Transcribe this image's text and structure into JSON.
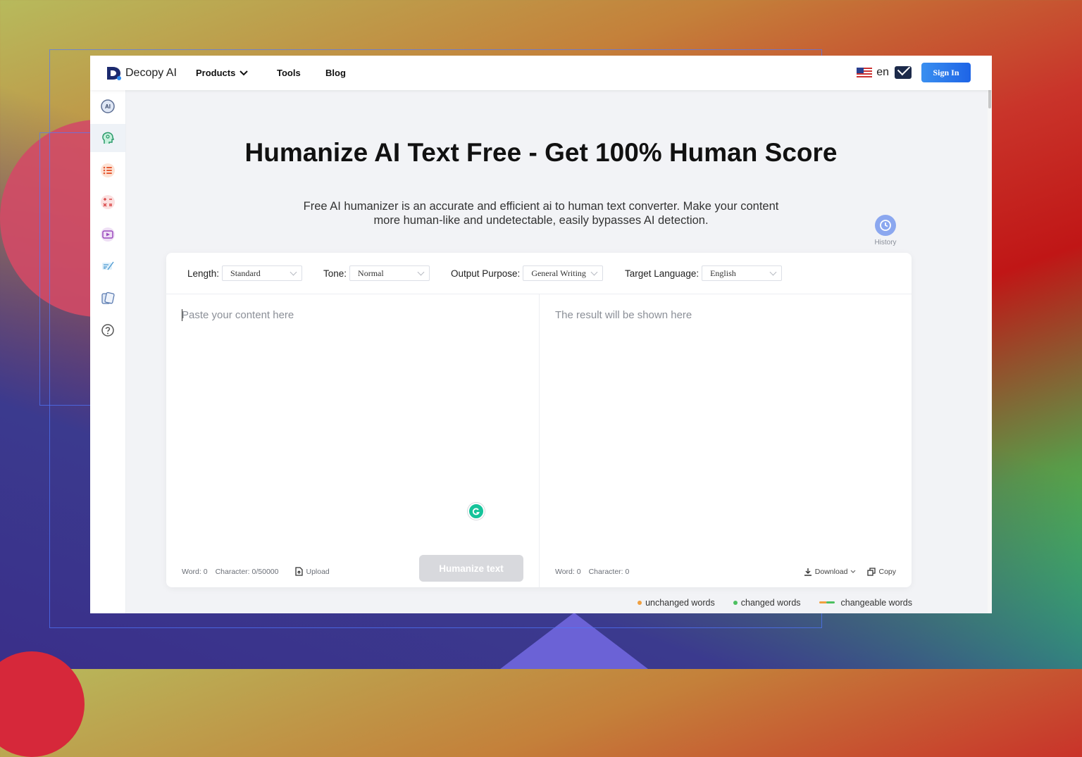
{
  "brand": {
    "name": "Decopy AI"
  },
  "nav": {
    "items": [
      {
        "label": "Products",
        "has_dropdown": true
      },
      {
        "label": "Tools",
        "has_dropdown": false
      },
      {
        "label": "Blog",
        "has_dropdown": false
      }
    ],
    "language": "en",
    "sign_in_label": "Sign In"
  },
  "sidebar": {
    "items": [
      {
        "icon": "ai-detector-icon",
        "active": false
      },
      {
        "icon": "humanizer-head-icon",
        "active": true
      },
      {
        "icon": "list-icon",
        "active": false
      },
      {
        "icon": "calculator-icon",
        "active": false
      },
      {
        "icon": "video-play-icon",
        "active": false
      },
      {
        "icon": "pen-paper-icon",
        "active": false
      },
      {
        "icon": "cards-icon",
        "active": false
      },
      {
        "icon": "help-icon",
        "active": false
      }
    ]
  },
  "hero": {
    "title": "Humanize AI Text Free - Get 100% Human Score",
    "subtitle_line1": "Free AI humanizer is an accurate and efficient ai to human text converter. Make your content",
    "subtitle_line2": "more human-like and undetectable, easily bypasses AI detection."
  },
  "history": {
    "label": "History"
  },
  "options": {
    "length": {
      "label": "Length:",
      "value": "Standard"
    },
    "tone": {
      "label": "Tone:",
      "value": "Normal"
    },
    "purpose": {
      "label": "Output Purpose:",
      "value": "General Writing"
    },
    "target_language": {
      "label": "Target Language:",
      "value": "English"
    }
  },
  "input_pane": {
    "placeholder": "Paste your content here",
    "word_count": "Word: 0",
    "char_count": "Character: 0/50000",
    "upload_label": "Upload",
    "humanize_label": "Humanize text"
  },
  "output_pane": {
    "placeholder": "The result will be shown here",
    "word_count": "Word: 0",
    "char_count": "Character: 0",
    "download_label": "Download",
    "copy_label": "Copy"
  },
  "legend": {
    "unchanged": "unchanged words",
    "changed": "changed words",
    "changeable": "changeable words"
  },
  "colors": {
    "accent": "#1e64e6",
    "unchanged": "#f0a040",
    "changed": "#4cc060",
    "humanize_disabled": "#d8d9dd"
  }
}
